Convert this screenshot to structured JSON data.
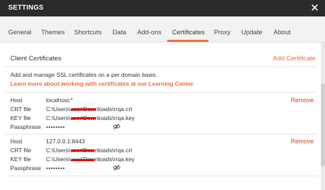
{
  "window": {
    "title": "SETTINGS"
  },
  "tabs": [
    {
      "label": "General"
    },
    {
      "label": "Themes"
    },
    {
      "label": "Shortcuts"
    },
    {
      "label": "Data"
    },
    {
      "label": "Add-ons"
    },
    {
      "label": "Certificates",
      "active": true
    },
    {
      "label": "Proxy"
    },
    {
      "label": "Update"
    },
    {
      "label": "About"
    }
  ],
  "section": {
    "title": "Client Certificates",
    "add_label": "Add Certificate",
    "description": "Add and manage SSL certificates on a per domain basis.",
    "learn_link": "Learn more about working with certificates at our Learning Center."
  },
  "labels": {
    "host": "Host",
    "crt": "CRT file",
    "key": "KEY file",
    "passphrase": "Passphrase",
    "remove": "Remove"
  },
  "certificates": [
    {
      "host": "localhost:*",
      "crt_file": "C:\\Users\\user\\Downloads\\rrqa.crt",
      "key_file": "C:\\Users\\user\\Downloads\\rrqa.key",
      "passphrase": "••••••••"
    },
    {
      "host": "127.0.0.1:8443",
      "crt_file": "C:\\Users\\user\\Downloads\\rrqa.crt",
      "key_file": "C:\\Users\\user\\Downloads\\rrqa.key",
      "passphrase": "••••••••"
    }
  ],
  "colors": {
    "accent": "#f26b3a",
    "remove": "#d0451b",
    "titlebar": "#2b2b2b",
    "redaction": "#e00000"
  },
  "icons": {
    "close": "close-icon",
    "toggle_visibility": "eye-slash-icon"
  }
}
